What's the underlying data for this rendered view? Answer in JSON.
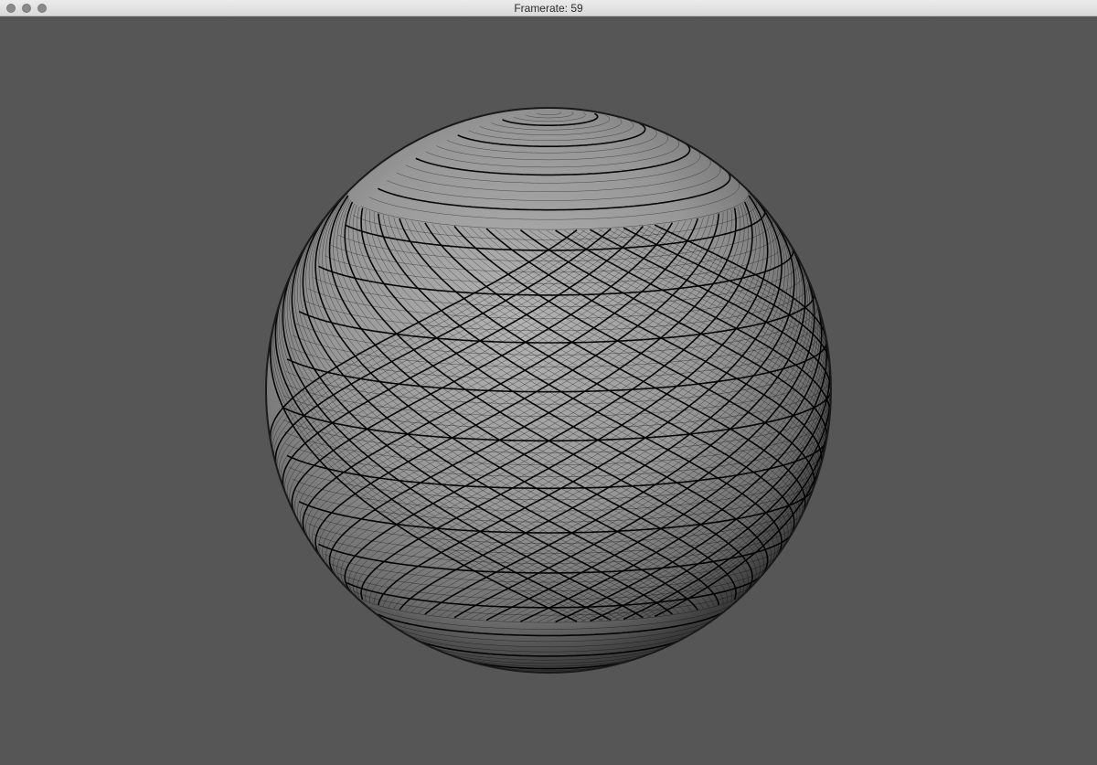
{
  "window": {
    "title": "Framerate: 59",
    "controls": [
      "close",
      "minimize",
      "zoom"
    ]
  },
  "scene": {
    "object": "wireframe-sphere",
    "background_color": "#565656",
    "sphere_color": "#9a9a9a",
    "wire_color": "#000000"
  }
}
